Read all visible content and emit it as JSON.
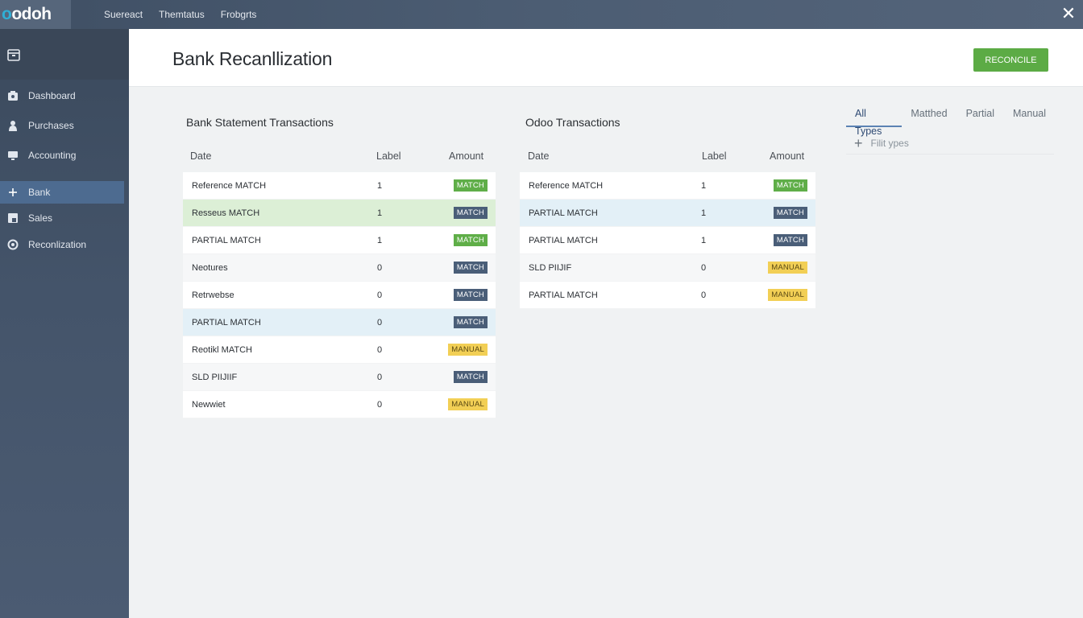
{
  "topbar": {
    "logo_o": "o",
    "logo_rest": "odoh",
    "nav": [
      "Suereact",
      "Themtatus",
      "Frobgrts"
    ],
    "close": "✕"
  },
  "sidebar": {
    "items": [
      {
        "label": "Dashboard",
        "icon": "dashboard-icon"
      },
      {
        "label": "Purchases",
        "icon": "person-icon"
      },
      {
        "label": "Accounting",
        "icon": "monitor-icon"
      },
      {
        "label": "Bank",
        "icon": "plus-icon",
        "active": true
      },
      {
        "label": "Sales",
        "icon": "document-icon"
      },
      {
        "label": "Reconlization",
        "icon": "target-icon"
      }
    ]
  },
  "header": {
    "title": "Bank Recanllization",
    "reconcile": "RECONCILE"
  },
  "bank_table": {
    "title": "Bank Statement Transactions",
    "columns": [
      "Date",
      "Label",
      "Amount"
    ],
    "rows": [
      {
        "label": "Reference MATCH",
        "num": "1",
        "badge": "MATCH",
        "type": "match-green",
        "bg": ""
      },
      {
        "label": "Resseus MATCH",
        "num": "1",
        "badge": "MATCH",
        "type": "match-blue",
        "bg": "green"
      },
      {
        "label": "PARTIAL MATCH",
        "num": "1",
        "badge": "MATCH",
        "type": "match-green",
        "bg": ""
      },
      {
        "label": "Neotures",
        "num": "0",
        "badge": "MATCH",
        "type": "match-blue",
        "bg": "grey"
      },
      {
        "label": "Retrwebse",
        "num": "0",
        "badge": "MATCH",
        "type": "match-blue",
        "bg": ""
      },
      {
        "label": "PARTIAL MATCH",
        "num": "0",
        "badge": "MATCH",
        "type": "match-blue",
        "bg": "blue"
      },
      {
        "label": "Reotikl MATCH",
        "num": "0",
        "badge": "MANUAL",
        "type": "manual",
        "bg": ""
      },
      {
        "label": "SLD PIIJIIF",
        "num": "0",
        "badge": "MATCH",
        "type": "match-blue",
        "bg": "grey"
      },
      {
        "label": "Newwiet",
        "num": "0",
        "badge": "MANUAL",
        "type": "manual",
        "bg": ""
      }
    ]
  },
  "odoo_table": {
    "title": "Odoo Transactions",
    "columns": [
      "Date",
      "Label",
      "Amount"
    ],
    "rows": [
      {
        "label": "Reference MATCH",
        "num": "1",
        "badge": "MATCH",
        "type": "match-green",
        "bg": ""
      },
      {
        "label": "PARTIAL MATCH",
        "num": "1",
        "badge": "MATCH",
        "type": "match-blue",
        "bg": "blue"
      },
      {
        "label": "PARTIAL MATCH",
        "num": "1",
        "badge": "MATCH",
        "type": "match-blue",
        "bg": ""
      },
      {
        "label": "SLD PIIJIF",
        "num": "0",
        "badge": "MANUAL",
        "type": "manual",
        "bg": "grey"
      },
      {
        "label": "PARTIAL MATCH",
        "num": "0",
        "badge": "MANUAL",
        "type": "manual",
        "bg": ""
      }
    ]
  },
  "filters": {
    "tabs": [
      "All Types",
      "Matthed",
      "Partial",
      "Manual"
    ],
    "active_tab": 0,
    "plus": "+",
    "placeholder": "Filit ypes"
  },
  "colors": {
    "accent_green": "#5cab45",
    "active_sidebar": "#4d6b90",
    "badge_blue": "#4a5e78",
    "badge_manual": "#f2cf55"
  }
}
